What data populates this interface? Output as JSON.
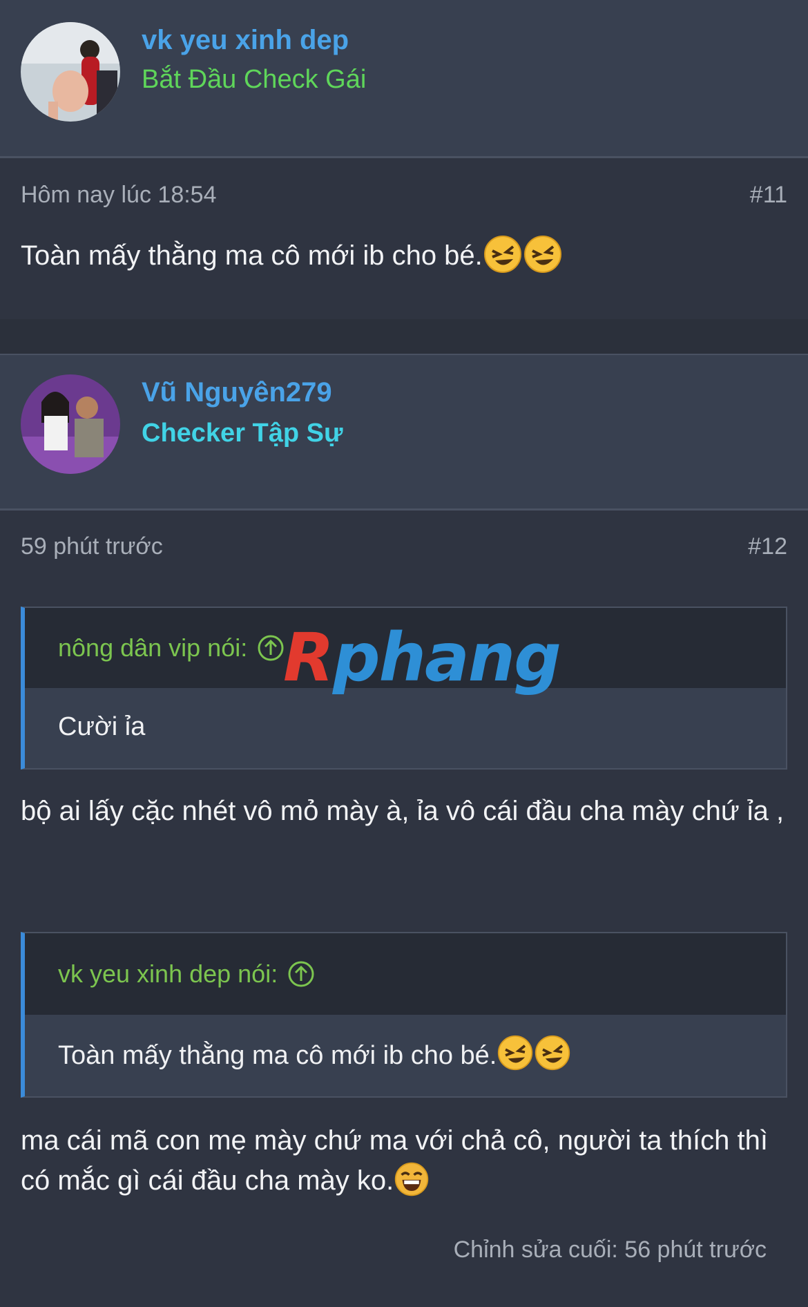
{
  "posts": [
    {
      "user": {
        "name": "vk yeu xinh dep",
        "title": "Bắt Đầu Check Gái"
      },
      "date": "Hôm nay lúc 18:54",
      "number": "#11",
      "text": "Toàn mấy thằng ma cô mới ib cho bé.",
      "emoji": "rolling-on-floor-laughing-icon"
    },
    {
      "user": {
        "name": "Vũ Nguyên279",
        "title": "Checker Tập Sự"
      },
      "date": "59 phút trước",
      "number": "#12",
      "quote1": {
        "author": "nông dân vip nói:",
        "text": "Cười ỉa"
      },
      "reply1": "bộ ai lấy cặc nhét vô mỏ mày à, ỉa vô cái đầu cha mày chứ ỉa ,",
      "quote2": {
        "author": "vk yeu xinh dep nói:",
        "text": "Toàn mấy thằng ma cô mới ib cho bé."
      },
      "reply2": "ma cái mã con mẹ mày chứ ma với chả cô, người ta thích thì có mắc gì cái đầu cha mày ko.",
      "edited": "Chỉnh sửa cuối: 56 phút trước"
    }
  ],
  "watermark": {
    "first": "R",
    "rest": "phang"
  },
  "colors": {
    "background": "#2b303b",
    "header": "#384050",
    "username": "#4aa3e8",
    "title1": "#5fd65a",
    "title2": "#41d3e6",
    "quote_author": "#7cc54f",
    "quote_bar": "#3b8bd9"
  }
}
